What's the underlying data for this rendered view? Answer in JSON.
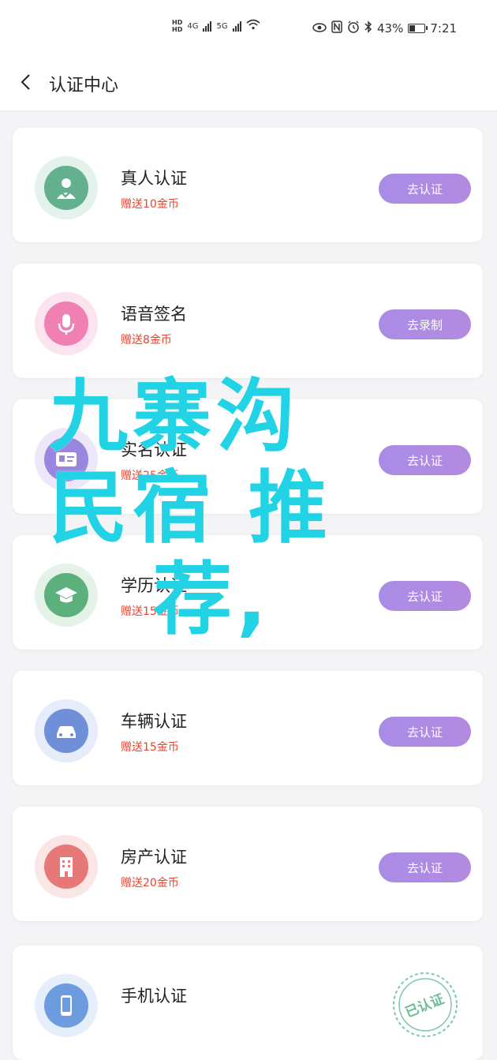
{
  "status_bar": {
    "hd_top": "HD",
    "hd_bottom": "HD",
    "net_1": "4G",
    "net_2": "5G",
    "battery_percent": "43%",
    "time": "7:21"
  },
  "header": {
    "title": "认证中心"
  },
  "cards": [
    {
      "title": "真人认证",
      "reward": "赠送10金币",
      "button": "去认证",
      "ring": "#e4f2ec",
      "fill": "#62b08e"
    },
    {
      "title": "语音签名",
      "reward": "赠送8金币",
      "button": "去录制",
      "ring": "#fbe4ef",
      "fill": "#f07fb2"
    },
    {
      "title": "实名认证",
      "reward": "赠送25金币",
      "button": "去认证",
      "ring": "#ece8f9",
      "fill": "#9a86de"
    },
    {
      "title": "学历认证",
      "reward": "赠送15金币",
      "button": "去认证",
      "ring": "#e4f2e8",
      "fill": "#5cb07c"
    },
    {
      "title": "车辆认证",
      "reward": "赠送15金币",
      "button": "去认证",
      "ring": "#e6ecf9",
      "fill": "#6f8fd9"
    },
    {
      "title": "房产认证",
      "reward": "赠送20金币",
      "button": "去认证",
      "ring": "#fbe6e6",
      "fill": "#e77878"
    },
    {
      "title": "手机认证",
      "reward": "",
      "button": "",
      "stamp": "已认证",
      "ring": "#e5eefb",
      "fill": "#6d9be0"
    }
  ],
  "overlay": {
    "line1": "九寨沟",
    "line2": "民宿 推",
    "line3": "荐,"
  },
  "colors": {
    "accent": "#a98ce6",
    "reward": "#e8432d",
    "overlay": "#22d3e6",
    "stamp": "#7fc9a6"
  }
}
